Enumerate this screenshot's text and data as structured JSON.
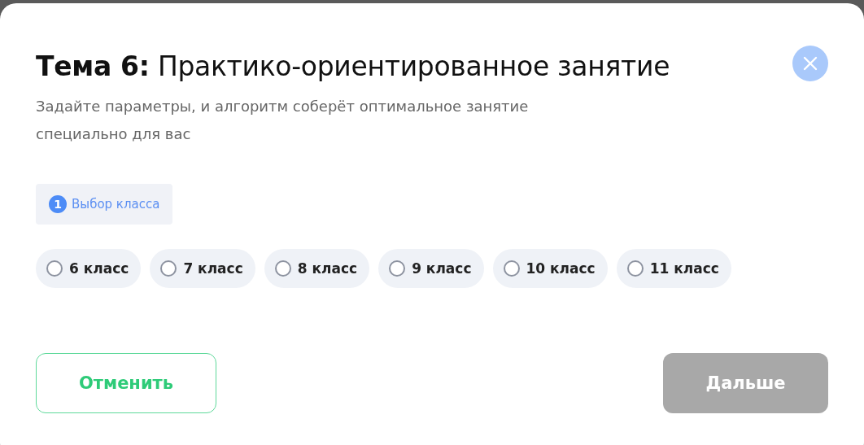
{
  "dialog": {
    "title": "**Тема 6:** Практико-ориентированное занятие",
    "subtitle": "Задайте параметры, и алгоритм соберёт оптимальное занятие специально для вас"
  },
  "step": {
    "number": "1",
    "label": "Выбор класса"
  },
  "options": [
    {
      "label": "6 класс",
      "selected": false
    },
    {
      "label": "7 класс",
      "selected": false
    },
    {
      "label": "8 класс",
      "selected": false
    },
    {
      "label": "9 класс",
      "selected": false
    },
    {
      "label": "10 класс",
      "selected": false
    },
    {
      "label": "11 класс",
      "selected": false
    }
  ],
  "buttons": [
    {
      "label": "Отменить",
      "kind": "secondary",
      "disabled": false
    },
    {
      "label": "Дальше",
      "kind": "primary",
      "disabled": true
    }
  ]
}
